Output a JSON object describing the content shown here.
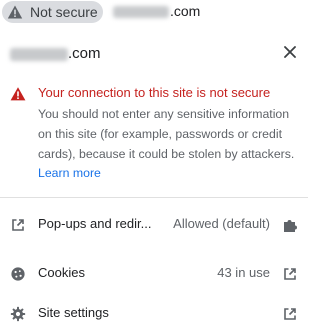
{
  "omnibox": {
    "security_chip_label": "Not secure",
    "security_icon": "warning-triangle-icon",
    "url_suffix": ".com"
  },
  "popup": {
    "site_suffix": ".com",
    "close_icon": "close-icon",
    "warning": {
      "icon": "warning-triangle-icon",
      "title": "Your connection to this site is not secure",
      "description": "You should not enter any sensitive information on this site (for example, passwords or credit cards), because it could be stolen by attackers.",
      "learn_more": "Learn more"
    },
    "rows": {
      "popups": {
        "icon": "external-link-icon",
        "label": "Pop-ups and redir...",
        "value": "Allowed (default)",
        "trailing_icon": "puzzle-extension-icon"
      },
      "cookies": {
        "icon": "cookie-icon",
        "label": "Cookies",
        "value": "43 in use",
        "trailing_icon": "open-in-new-icon"
      },
      "site_settings": {
        "icon": "gear-icon",
        "label": "Site settings",
        "trailing_icon": "open-in-new-icon"
      }
    }
  },
  "colors": {
    "warning_red": "#c5221f",
    "link_blue": "#1a73e8",
    "chip_gray": "#dadce0",
    "secondary_text": "#5f6368"
  }
}
